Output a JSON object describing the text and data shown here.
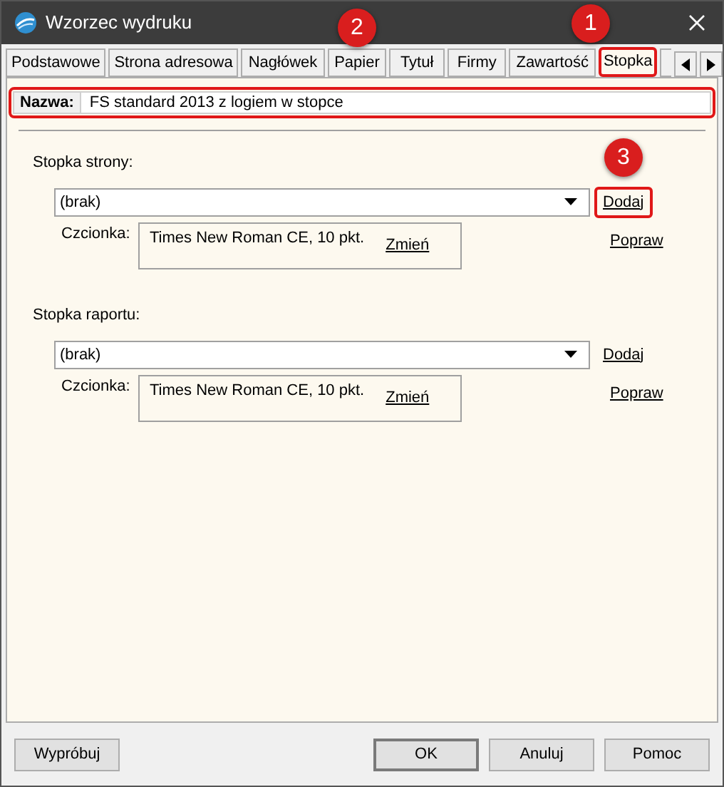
{
  "window": {
    "title": "Wzorzec wydruku"
  },
  "tabs": [
    {
      "label": "Podstawowe",
      "selected": false,
      "highlighted": false
    },
    {
      "label": "Strona adresowa",
      "selected": false,
      "highlighted": false
    },
    {
      "label": "Nagłówek",
      "selected": false,
      "highlighted": false
    },
    {
      "label": "Papier",
      "selected": false,
      "highlighted": false
    },
    {
      "label": "Tytuł",
      "selected": false,
      "highlighted": false
    },
    {
      "label": "Firmy",
      "selected": false,
      "highlighted": false
    },
    {
      "label": "Zawartość",
      "selected": false,
      "highlighted": false
    },
    {
      "label": "Stopka",
      "selected": true,
      "highlighted": true
    }
  ],
  "name_field": {
    "label": "Nazwa:",
    "value": "FS standard 2013 z logiem w stopce",
    "highlighted": true
  },
  "sections": [
    {
      "title": "Stopka strony:",
      "select_value": "(brak)",
      "add_link": "Dodaj",
      "add_highlighted": true,
      "font_label": "Czcionka:",
      "font_value": "Times New Roman CE, 10 pkt.",
      "change_link": "Zmień",
      "edit_link": "Popraw"
    },
    {
      "title": "Stopka raportu:",
      "select_value": "(brak)",
      "add_link": "Dodaj",
      "add_highlighted": false,
      "font_label": "Czcionka:",
      "font_value": "Times New Roman CE, 10 pkt.",
      "change_link": "Zmień",
      "edit_link": "Popraw"
    }
  ],
  "buttons": {
    "left": "Wypróbuj",
    "right": [
      {
        "label": "OK",
        "default": true
      },
      {
        "label": "Anuluj",
        "default": false
      },
      {
        "label": "Pomoc",
        "default": false
      }
    ]
  },
  "annotations": [
    {
      "number": "1"
    },
    {
      "number": "2"
    },
    {
      "number": "3"
    }
  ]
}
